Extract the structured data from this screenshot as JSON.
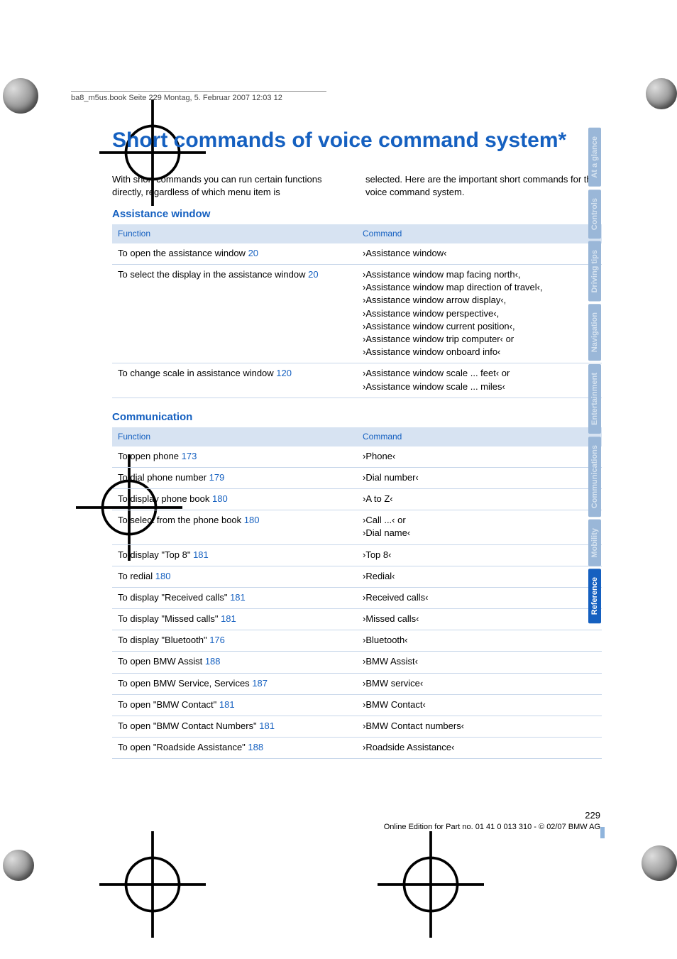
{
  "header_line": "ba8_m5us.book  Seite 229  Montag, 5. Februar 2007  12:03 12",
  "title": "Short commands of voice command system*",
  "intro": {
    "left": "With short commands you can run certain functions directly, regardless of which menu item is",
    "right": "selected. Here are the important short commands for the voice command system."
  },
  "sections": [
    {
      "heading": "Assistance window",
      "headers": {
        "func": "Function",
        "cmd": "Command"
      },
      "rows": [
        {
          "func": "To open the assistance window",
          "page": "20",
          "cmd": "›Assistance window‹"
        },
        {
          "func": "To select the display in the assistance window",
          "page": "20",
          "cmd": "›Assistance window map facing north‹,\n›Assistance window map direction of travel‹,\n›Assistance window arrow display‹,\n›Assistance window perspective‹,\n›Assistance window current position‹,\n›Assistance window trip computer‹ or\n›Assistance window onboard info‹"
        },
        {
          "func": "To change scale in assistance window",
          "page": "120",
          "cmd": "›Assistance window scale ... feet‹ or\n›Assistance window scale ... miles‹"
        }
      ]
    },
    {
      "heading": "Communication",
      "headers": {
        "func": "Function",
        "cmd": "Command"
      },
      "rows": [
        {
          "func": "To open phone",
          "page": "173",
          "cmd": "›Phone‹"
        },
        {
          "func": "To dial phone number",
          "page": "179",
          "cmd": "›Dial number‹"
        },
        {
          "func": "To display phone book",
          "page": "180",
          "cmd": "›A to Z‹"
        },
        {
          "func": "To select from the phone book",
          "page": "180",
          "cmd": "›Call ...‹ or\n›Dial name‹"
        },
        {
          "func": "To display \"Top 8\"",
          "page": "181",
          "cmd": "›Top 8‹"
        },
        {
          "func": "To redial",
          "page": "180",
          "cmd": "›Redial‹"
        },
        {
          "func": "To display \"Received calls\"",
          "page": "181",
          "cmd": "›Received calls‹"
        },
        {
          "func": "To display \"Missed calls\"",
          "page": "181",
          "cmd": "›Missed calls‹"
        },
        {
          "func": "To display \"Bluetooth\"",
          "page": "176",
          "cmd": "›Bluetooth‹"
        },
        {
          "func": "To open BMW Assist",
          "page": "188",
          "cmd": "›BMW Assist‹"
        },
        {
          "func": "To open BMW Service, Services",
          "page": "187",
          "cmd": "›BMW service‹"
        },
        {
          "func": "To open \"BMW Contact\"",
          "page": "181",
          "cmd": "›BMW Contact‹"
        },
        {
          "func": "To open \"BMW Contact Numbers\"",
          "page": "181",
          "cmd": "›BMW Contact numbers‹"
        },
        {
          "func": "To open \"Roadside Assistance\"",
          "page": "188",
          "cmd": "›Roadside Assistance‹"
        }
      ]
    }
  ],
  "page_number": "229",
  "footer_small": "Online Edition for Part no. 01 41 0 013 310 - © 02/07 BMW AG",
  "tabs": [
    {
      "label": "At a glance",
      "active": false
    },
    {
      "label": "Controls",
      "active": false
    },
    {
      "label": "Driving tips",
      "active": false
    },
    {
      "label": "Navigation",
      "active": false
    },
    {
      "label": "Entertainment",
      "active": false
    },
    {
      "label": "Communications",
      "active": false
    },
    {
      "label": "Mobility",
      "active": false
    },
    {
      "label": "Reference",
      "active": true
    }
  ]
}
